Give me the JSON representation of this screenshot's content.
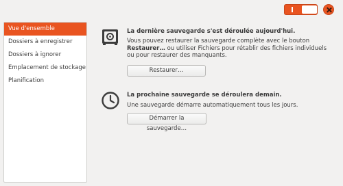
{
  "titlebar": {
    "toggle_state": "on",
    "accent": "#e95420"
  },
  "sidebar": {
    "items": [
      {
        "label": "Vue d'ensemble",
        "active": true
      },
      {
        "label": "Dossiers à enregistrer",
        "active": false
      },
      {
        "label": "Dossiers à ignorer",
        "active": false
      },
      {
        "label": "Emplacement de stockage",
        "active": false
      },
      {
        "label": "Planification",
        "active": false
      }
    ]
  },
  "last_backup": {
    "icon": "safe-icon",
    "heading": "La dernière sauvegarde s'est déroulée aujourd'hui.",
    "body_1": "Vous pouvez restaurer la sauvegarde complète avec le bouton",
    "body_2_bold": "Restaurer…",
    "body_2_rest": " ou utiliser Fichiers pour rétablir des fichiers individuels",
    "body_3": "ou pour restaurer des manquants.",
    "button": "Restaurer…"
  },
  "next_backup": {
    "icon": "clock-icon",
    "heading": "La prochaine sauvegarde se déroulera demain.",
    "body": "Une sauvegarde démarre automatiquement tous les jours.",
    "button": "Démarrer la sauvegarde…"
  }
}
